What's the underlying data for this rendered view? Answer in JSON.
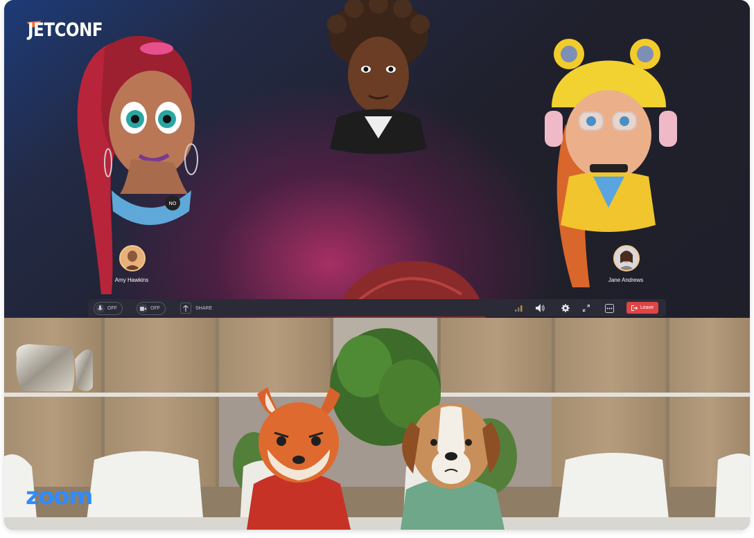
{
  "jetconf": {
    "logo_text": "JETCONF",
    "participants": [
      {
        "name": "Amy Hawkins"
      },
      {
        "name": "Jane Andrews"
      }
    ],
    "controls": {
      "mic_label": "OFF",
      "camera_label": "OFF",
      "share_label": "SHARE",
      "leave_label": "Leave"
    }
  },
  "zoom": {
    "logo_text": "zoom"
  },
  "colors": {
    "leave_button": "#e04545",
    "zoom_brand": "#2d8cff",
    "thumb_ring": "#f3c98b"
  }
}
